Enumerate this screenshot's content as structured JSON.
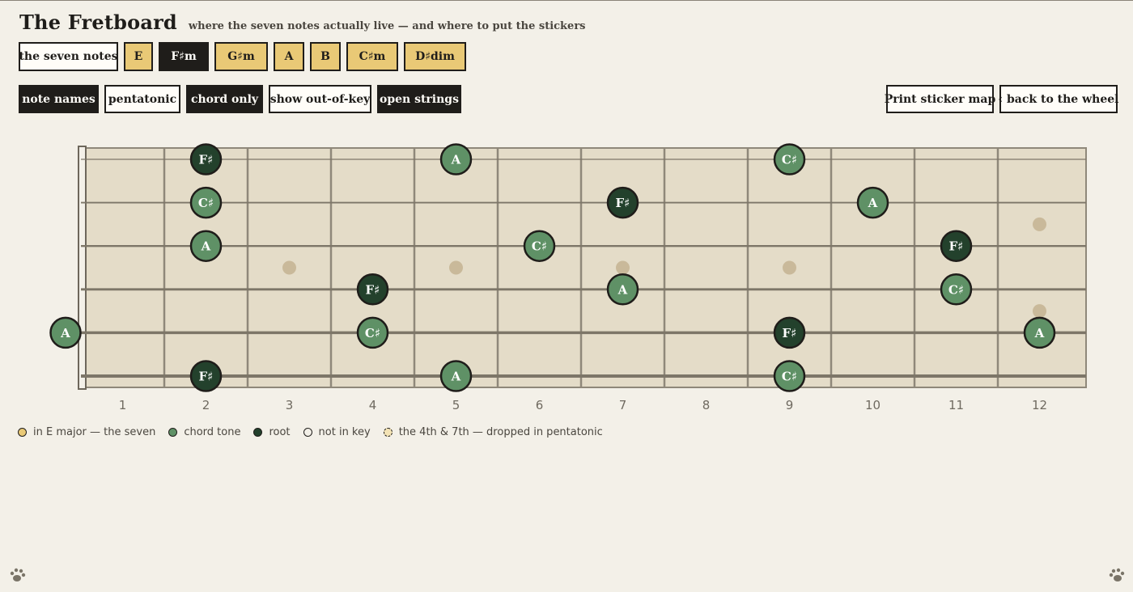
{
  "header": {
    "title": "The Fretboard",
    "subtitle": "where the seven notes actually live — and where to put the stickers"
  },
  "chords": [
    {
      "label": "the seven notes",
      "state": "white"
    },
    {
      "label": "E",
      "state": "gold"
    },
    {
      "label": "F♯m",
      "state": "dark"
    },
    {
      "label": "G♯m",
      "state": "gold"
    },
    {
      "label": "A",
      "state": "gold"
    },
    {
      "label": "B",
      "state": "gold"
    },
    {
      "label": "C♯m",
      "state": "gold"
    },
    {
      "label": "D♯dim",
      "state": "gold"
    }
  ],
  "toggles": [
    {
      "label": "note names",
      "active": true
    },
    {
      "label": "pentatonic",
      "active": false
    },
    {
      "label": "chord only",
      "active": true
    },
    {
      "label": "show out-of-key",
      "active": false
    },
    {
      "label": "open strings",
      "active": true
    }
  ],
  "actions": {
    "print_label": "Print sticker map",
    "back_label": "‹ back to the wheel"
  },
  "fretboard": {
    "fret_numbers": [
      "1",
      "2",
      "3",
      "4",
      "5",
      "6",
      "7",
      "8",
      "9",
      "10",
      "11",
      "12"
    ],
    "inlays": [
      {
        "fret": 3,
        "type": "single"
      },
      {
        "fret": 5,
        "type": "single"
      },
      {
        "fret": 7,
        "type": "single"
      },
      {
        "fret": 9,
        "type": "single"
      },
      {
        "fret": 12,
        "type": "double"
      }
    ],
    "notes": [
      {
        "string": 1,
        "fret": 2,
        "label": "F♯",
        "role": "root"
      },
      {
        "string": 1,
        "fret": 5,
        "label": "A",
        "role": "chord"
      },
      {
        "string": 1,
        "fret": 9,
        "label": "C♯",
        "role": "chord"
      },
      {
        "string": 2,
        "fret": 2,
        "label": "C♯",
        "role": "chord"
      },
      {
        "string": 2,
        "fret": 7,
        "label": "F♯",
        "role": "root"
      },
      {
        "string": 2,
        "fret": 10,
        "label": "A",
        "role": "chord"
      },
      {
        "string": 3,
        "fret": 2,
        "label": "A",
        "role": "chord"
      },
      {
        "string": 3,
        "fret": 6,
        "label": "C♯",
        "role": "chord"
      },
      {
        "string": 3,
        "fret": 11,
        "label": "F♯",
        "role": "root"
      },
      {
        "string": 4,
        "fret": 4,
        "label": "F♯",
        "role": "root"
      },
      {
        "string": 4,
        "fret": 7,
        "label": "A",
        "role": "chord"
      },
      {
        "string": 4,
        "fret": 11,
        "label": "C♯",
        "role": "chord"
      },
      {
        "string": 5,
        "fret": 0,
        "label": "A",
        "role": "chord"
      },
      {
        "string": 5,
        "fret": 4,
        "label": "C♯",
        "role": "chord"
      },
      {
        "string": 5,
        "fret": 9,
        "label": "F♯",
        "role": "root"
      },
      {
        "string": 5,
        "fret": 12,
        "label": "A",
        "role": "chord"
      },
      {
        "string": 6,
        "fret": 2,
        "label": "F♯",
        "role": "root"
      },
      {
        "string": 6,
        "fret": 5,
        "label": "A",
        "role": "chord"
      },
      {
        "string": 6,
        "fret": 9,
        "label": "C♯",
        "role": "chord"
      }
    ]
  },
  "legend": [
    {
      "label": "in E major — the seven",
      "swatch": "gold"
    },
    {
      "label": "chord tone",
      "swatch": "chord"
    },
    {
      "label": "root",
      "swatch": "root"
    },
    {
      "label": "not in key",
      "swatch": "out"
    },
    {
      "label": "the 4th & 7th — dropped in pentatonic",
      "swatch": "dashed"
    }
  ],
  "colors": {
    "gold": "#e9c976",
    "chord": "#5f9166",
    "root": "#23412c",
    "out": "#f3f0e8",
    "ink": "#1f1d1a",
    "board": "#e4dcc8",
    "fret": "#8f887a",
    "inlay": "#c9b99a"
  },
  "icons": {
    "corner_left": "paw-print-icon",
    "corner_right": "paw-print-icon"
  }
}
